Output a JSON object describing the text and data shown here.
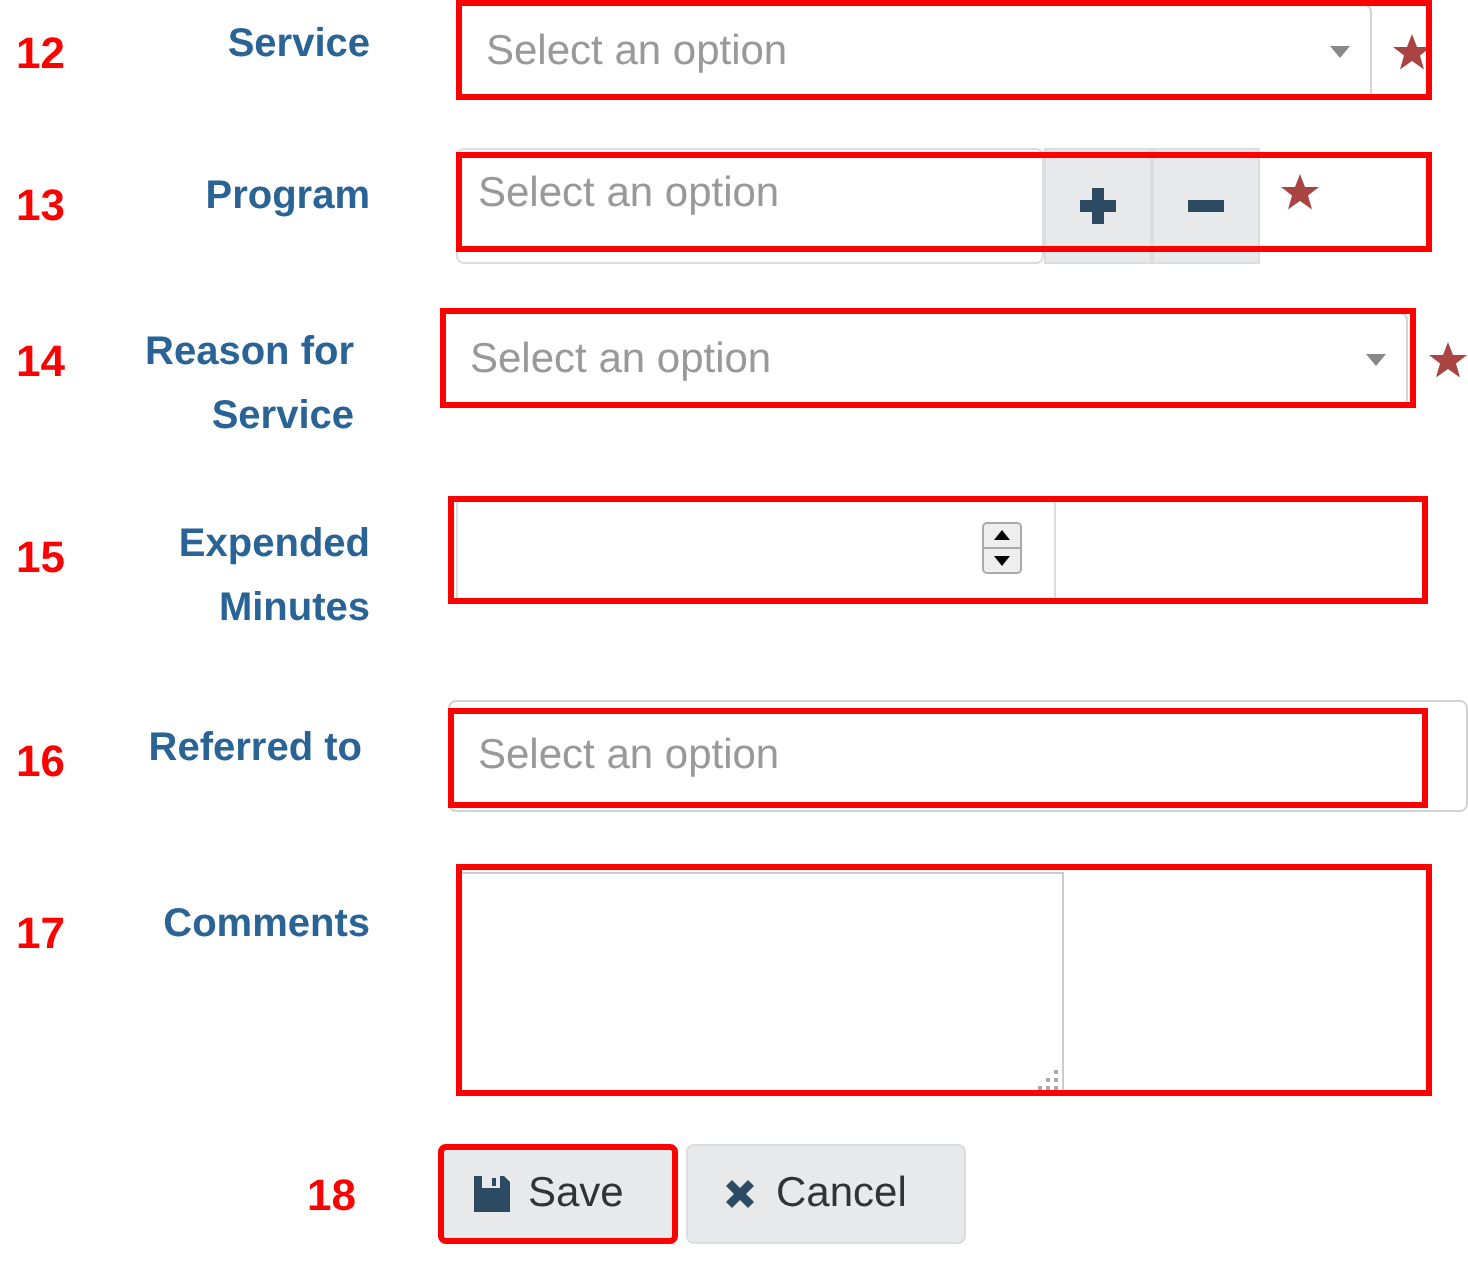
{
  "fields": [
    {
      "marker": "12",
      "label": "Service",
      "kind": "select",
      "placeholder": "Select an option",
      "required": true
    },
    {
      "marker": "13",
      "label": "Program",
      "kind": "select-addremove",
      "placeholder": "Select an option",
      "required": true
    },
    {
      "marker": "14",
      "label": "Reason for Service",
      "kind": "select",
      "placeholder": "Select an option",
      "required": true
    },
    {
      "marker": "15",
      "label": "Expended Minutes",
      "kind": "number",
      "required": false
    },
    {
      "marker": "16",
      "label": "Referred to",
      "kind": "select-plain",
      "placeholder": "Select an option",
      "required": false
    },
    {
      "marker": "17",
      "label": "Comments",
      "kind": "textarea",
      "required": false
    }
  ],
  "actions": {
    "marker": "18",
    "buttons": [
      {
        "label": "Save",
        "kind": "save",
        "highlighted": true
      },
      {
        "label": "Cancel",
        "kind": "cancel",
        "highlighted": false
      }
    ]
  }
}
